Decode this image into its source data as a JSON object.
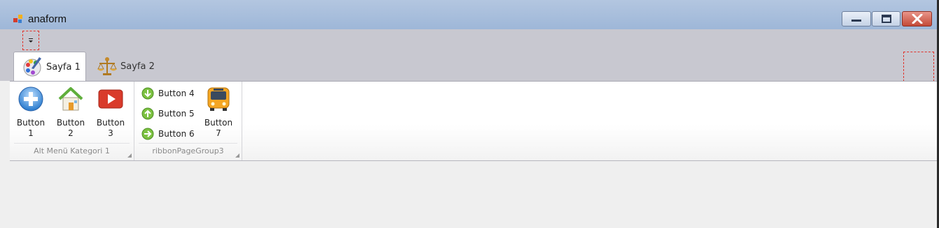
{
  "window": {
    "title": "anaform",
    "controls": {
      "minimize": "minimize-icon",
      "maximize": "maximize-icon",
      "close": "close-icon"
    }
  },
  "tabs": [
    {
      "label": "Sayfa 1",
      "active": true,
      "icon": "palette-brush-icon"
    },
    {
      "label": "Sayfa 2",
      "active": false,
      "icon": "scales-icon"
    }
  ],
  "groups": [
    {
      "caption": "Alt Menü Kategori 1",
      "buttons": [
        {
          "label_line1": "Button",
          "label_line2": "1",
          "icon": "plus-circle-icon"
        },
        {
          "label_line1": "Button",
          "label_line2": "2",
          "icon": "home-icon"
        },
        {
          "label_line1": "Button",
          "label_line2": "3",
          "icon": "play-icon"
        }
      ]
    },
    {
      "caption": "ribbonPageGroup3",
      "small_buttons": [
        {
          "label": "Button 4",
          "icon": "green-circle-down-icon"
        },
        {
          "label": "Button 5",
          "icon": "green-circle-up-icon"
        },
        {
          "label": "Button 6",
          "icon": "green-circle-right-icon"
        }
      ],
      "buttons": [
        {
          "label_line1": "Button",
          "label_line2": "7",
          "icon": "bus-icon"
        }
      ]
    }
  ],
  "colors": {
    "title_gradient_top": "#b3c6e0",
    "title_gradient_bottom": "#9eb7d8",
    "ribbon_bg": "#c8c8d0",
    "close_red": "#c44a38",
    "dashed_border": "#e0332b"
  }
}
